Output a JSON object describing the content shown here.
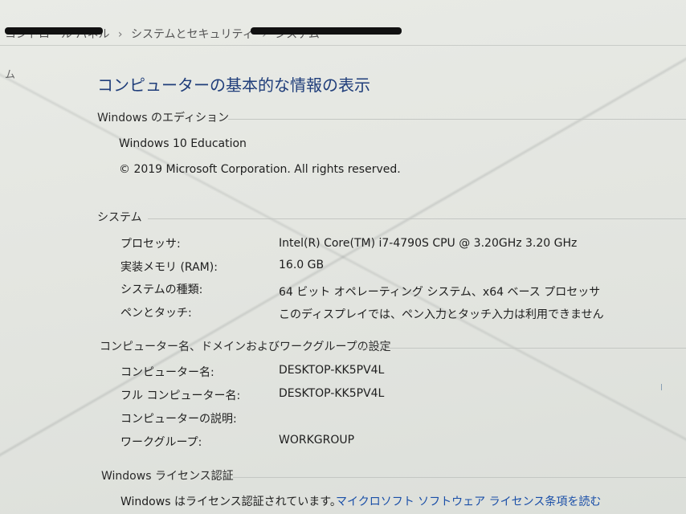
{
  "breadcrumb": {
    "items": [
      "コントロール パネル",
      "システムとセキュリティ",
      "システム"
    ],
    "separator": "›"
  },
  "left_glyph": "ム",
  "page_title": "コンピューターの基本的な情報の表示",
  "edition": {
    "heading": "Windows のエディション",
    "name": "Windows 10 Education",
    "copyright": "© 2019 Microsoft Corporation. All rights reserved."
  },
  "system": {
    "heading": "システム",
    "rows": [
      {
        "label": "プロセッサ:",
        "value": "Intel(R) Core(TM) i7-4790S CPU @ 3.20GHz   3.20 GHz"
      },
      {
        "label": "実装メモリ (RAM):",
        "value": "16.0 GB"
      },
      {
        "label": "システムの種類:",
        "value": "64 ビット オペレーティング システム、x64 ベース プロセッサ"
      },
      {
        "label": "ペンとタッチ:",
        "value": "このディスプレイでは、ペン入力とタッチ入力は利用できません"
      }
    ]
  },
  "computer": {
    "heading": "コンピューター名、ドメインおよびワークグループの設定",
    "rows": [
      {
        "label": "コンピューター名:",
        "value": "DESKTOP-KK5PV4L"
      },
      {
        "label": "フル コンピューター名:",
        "value": "DESKTOP-KK5PV4L"
      },
      {
        "label": "コンピューターの説明:",
        "value": ""
      },
      {
        "label": "ワークグループ:",
        "value": "WORKGROUP"
      }
    ]
  },
  "license": {
    "heading": "Windows ライセンス認証",
    "status": "Windows はライセンス認証されています。",
    "link": "マイクロソフト ソフトウェア ライセンス条項を読む"
  },
  "colors": {
    "title": "#1f3d7a",
    "link": "#1a4fa8",
    "background": "#e4e6e1"
  }
}
